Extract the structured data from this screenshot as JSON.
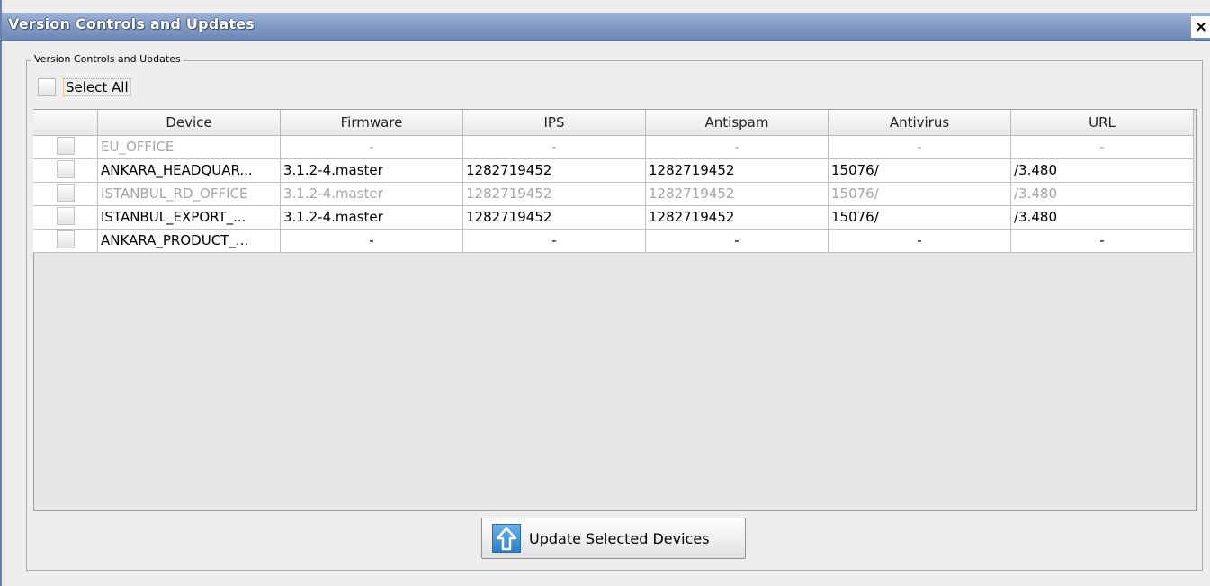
{
  "window": {
    "title": "Version Controls and Updates",
    "close_symbol": "×"
  },
  "group": {
    "legend": "Version Controls and Updates",
    "select_all_label": "Select All",
    "select_all_checked": false
  },
  "table": {
    "columns": [
      "",
      "Device",
      "Firmware",
      "IPS",
      "Antispam",
      "Antivirus",
      "URL"
    ],
    "rows": [
      {
        "enabled": false,
        "checked": false,
        "device": "EU_OFFICE",
        "firmware": "-",
        "ips": "-",
        "antispam": "-",
        "antivirus": "-",
        "url": "-"
      },
      {
        "enabled": true,
        "checked": false,
        "device": "ANKARA_HEADQUAR...",
        "firmware": "3.1.2-4.master",
        "ips": "1282719452",
        "antispam": "1282719452",
        "antivirus": "15076/",
        "url": "/3.480"
      },
      {
        "enabled": false,
        "checked": false,
        "device": "ISTANBUL_RD_OFFICE",
        "firmware": "3.1.2-4.master",
        "ips": "1282719452",
        "antispam": "1282719452",
        "antivirus": "15076/",
        "url": "/3.480"
      },
      {
        "enabled": true,
        "checked": false,
        "device": "ISTANBUL_EXPORT_...",
        "firmware": "3.1.2-4.master",
        "ips": "1282719452",
        "antispam": "1282719452",
        "antivirus": "15076/",
        "url": "/3.480"
      },
      {
        "enabled": true,
        "checked": false,
        "device": "ANKARA_PRODUCT_...",
        "firmware": "-",
        "ips": "-",
        "antispam": "-",
        "antivirus": "-",
        "url": "-"
      }
    ]
  },
  "actions": {
    "update_label": "Update Selected Devices",
    "update_icon": "arrow-up-icon"
  },
  "colors": {
    "titlebar": "#7f97c3",
    "disabled_text": "#a6a6a6",
    "icon_blue": "#2e7dc4"
  }
}
